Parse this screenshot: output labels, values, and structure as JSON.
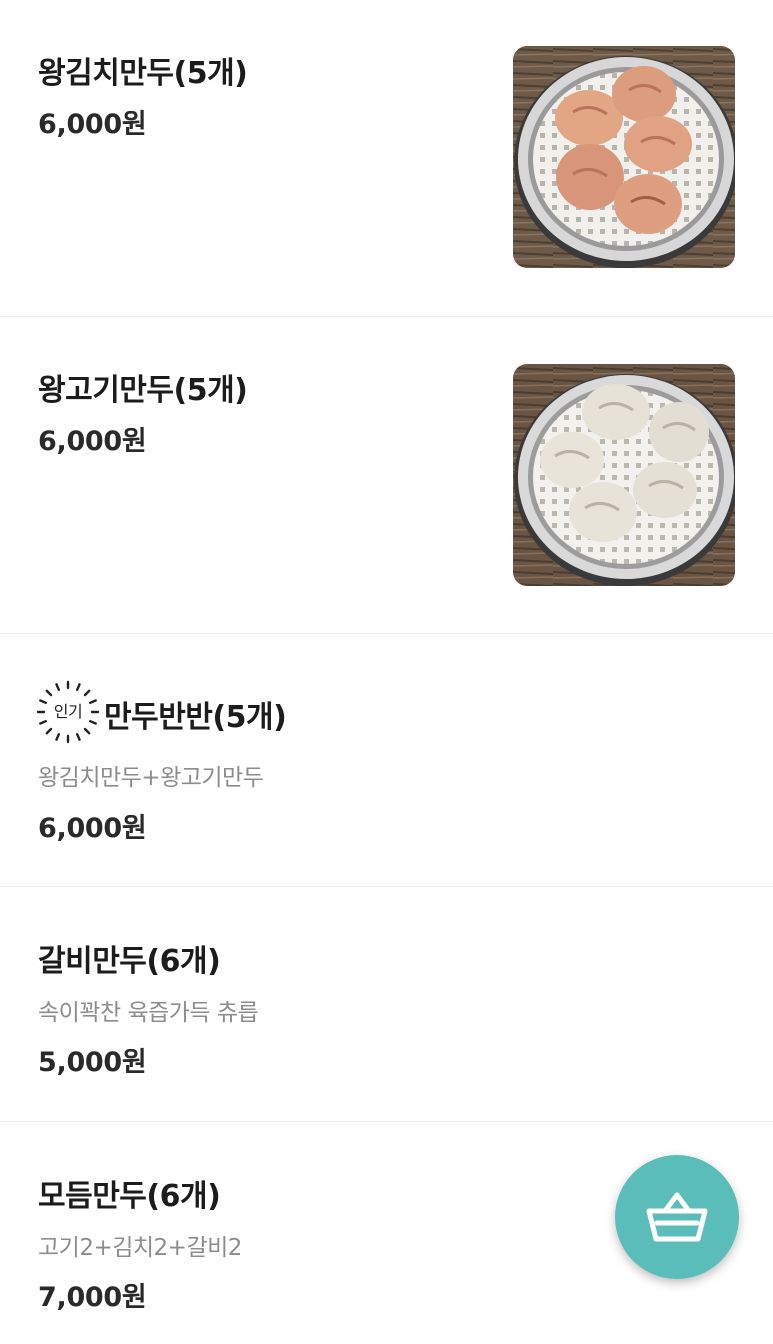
{
  "menu": {
    "items": [
      {
        "name": "왕김치만두(5개)",
        "description": "",
        "price": "6,000원",
        "photo": "kimchi-dumplings-photo"
      },
      {
        "name": "왕고기만두(5개)",
        "description": "",
        "price": "6,000원",
        "photo": "meat-dumplings-photo"
      },
      {
        "name": "만두반반(5개)",
        "badge": "인기",
        "description": "왕김치만두+왕고기만두",
        "price": "6,000원"
      },
      {
        "name": "갈비만두(6개)",
        "description": "속이꽉찬 육즙가득 츄릅",
        "price": "5,000원"
      },
      {
        "name": "모듬만두(6개)",
        "description": "고기2+김치2+갈비2",
        "price": "7,000원"
      }
    ]
  },
  "cart_button": {
    "icon": "basket-icon"
  },
  "colors": {
    "accent": "#5bbdb9",
    "divider": "#ececec",
    "price_text": "#2a2a2a",
    "description_text": "#8c8c8c"
  }
}
